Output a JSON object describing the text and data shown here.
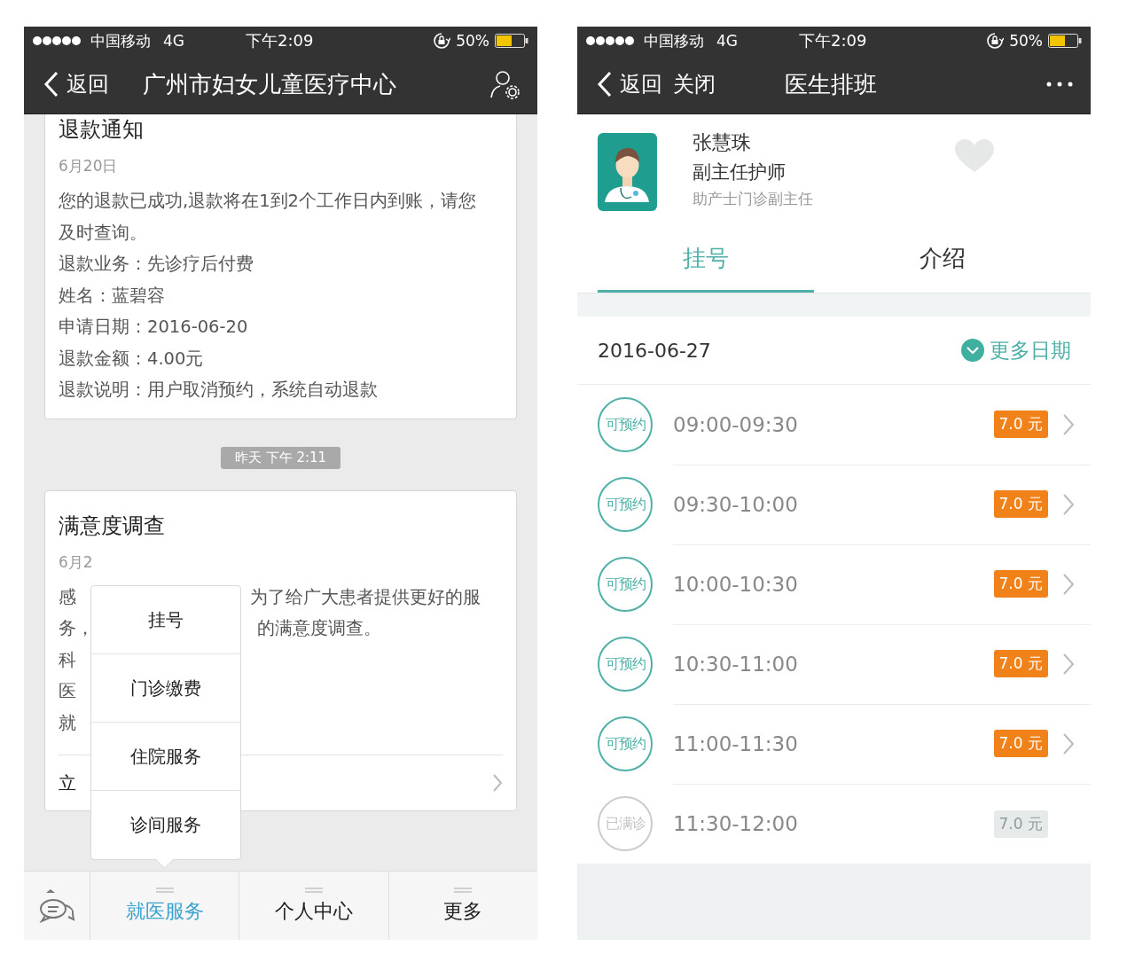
{
  "left_screen": {
    "status_bar": {
      "carrier": "中国移动",
      "network": "4G",
      "time": "下午2:09",
      "battery": "50%"
    },
    "nav": {
      "back": "返回",
      "title": "广州市妇女儿童医疗中心"
    },
    "messages": [
      {
        "kind": "notice",
        "title": "退款通知",
        "date": "6月20日",
        "lines": [
          "您的退款已成功,退款将在1到2个工作日内到账，请您及时查询。",
          "退款业务：先诊疗后付费",
          "姓名：蓝碧容",
          "申请日期：2016-06-20",
          "退款金额：4.00元",
          "退款说明：用户取消预约，系统自动退款"
        ]
      },
      {
        "kind": "timestamp",
        "text": "昨天 下午 2:11"
      },
      {
        "kind": "survey",
        "title": "满意度调查",
        "date": "6月2",
        "lines": [
          {
            "left": "感",
            "right": "为了给广大患者提供更好的服"
          },
          {
            "left": "务，",
            "right": "的满意度调查。"
          },
          {
            "left": "科"
          },
          {
            "left": "医"
          },
          {
            "left": "就"
          }
        ],
        "action": "立"
      }
    ],
    "popup_menu": {
      "items": [
        "挂号",
        "门诊缴费",
        "住院服务",
        "诊间服务"
      ]
    },
    "tab_bar": {
      "items": [
        {
          "label": "就医服务",
          "selected": true
        },
        {
          "label": "个人中心",
          "selected": false
        },
        {
          "label": "更多",
          "selected": false
        }
      ]
    }
  },
  "right_screen": {
    "status_bar": {
      "carrier": "中国移动",
      "network": "4G",
      "time": "下午2:09",
      "battery": "50%"
    },
    "nav": {
      "back": "返回",
      "close": "关闭",
      "title": "医生排班"
    },
    "doctor": {
      "name": "张慧珠",
      "title": "副主任护师",
      "department": "助产士门诊副主任",
      "favorited": false
    },
    "tabs": [
      {
        "label": "挂号",
        "selected": true
      },
      {
        "label": "介绍",
        "selected": false
      }
    ],
    "date": "2016-06-27",
    "more_dates": "更多日期",
    "slots": [
      {
        "status": "可预约",
        "time": "09:00-09:30",
        "price": "7.0 元",
        "available": true
      },
      {
        "status": "可预约",
        "time": "09:30-10:00",
        "price": "7.0 元",
        "available": true
      },
      {
        "status": "可预约",
        "time": "10:00-10:30",
        "price": "7.0 元",
        "available": true
      },
      {
        "status": "可预约",
        "time": "10:30-11:00",
        "price": "7.0 元",
        "available": true
      },
      {
        "status": "可预约",
        "time": "11:00-11:30",
        "price": "7.0 元",
        "available": true
      },
      {
        "status": "已满诊",
        "time": "11:30-12:00",
        "price": "7.0 元",
        "available": false
      }
    ]
  }
}
